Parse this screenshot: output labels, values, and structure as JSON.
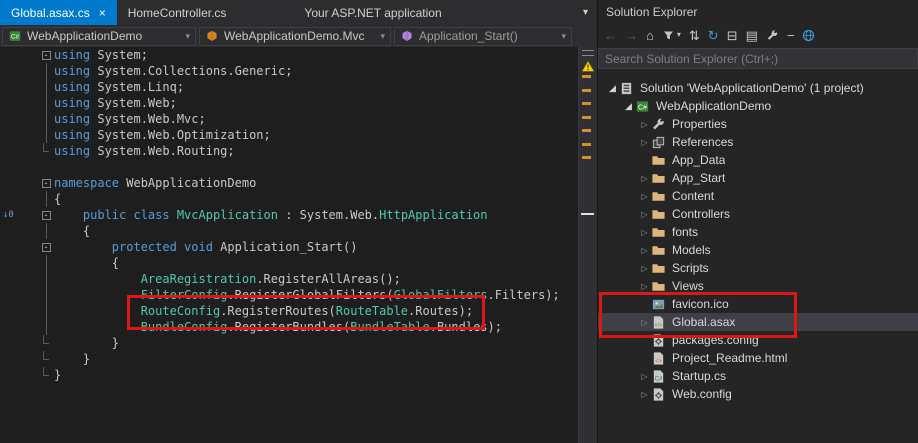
{
  "colors": {
    "accent": "#007acc",
    "annotation_red": "#dd1616",
    "keyword": "#569cd6",
    "type_name": "#4ec9b0",
    "plain_code": "#c8c8c8",
    "modified_tick": "#d18f2d",
    "warning_yellow": "#ffcc00"
  },
  "icons": {
    "close": "×",
    "chevron_down": "▾",
    "collapsed_expander": "▷",
    "expanded_expander": "◢"
  },
  "tabs": [
    {
      "label": "Global.asax.cs",
      "active": true
    },
    {
      "label": "HomeController.cs",
      "active": false
    },
    {
      "label": "Your ASP.NET application",
      "active": false,
      "gap_before": true
    }
  ],
  "navbar": {
    "project_label": "WebApplicationDemo",
    "type_label": "WebApplicationDemo.Mvc",
    "member_label": "Application_Start()"
  },
  "editor": {
    "lines": [
      {
        "fold": "start",
        "segs": [
          {
            "c": "kw",
            "t": "using"
          },
          {
            "c": "pl",
            "t": " System;"
          }
        ]
      },
      {
        "fold": "line",
        "segs": [
          {
            "c": "kw",
            "t": "using"
          },
          {
            "c": "pl",
            "t": " System.Collections.Generic;"
          }
        ]
      },
      {
        "fold": "line",
        "segs": [
          {
            "c": "kw",
            "t": "using"
          },
          {
            "c": "pl",
            "t": " System.Linq;"
          }
        ]
      },
      {
        "fold": "line",
        "segs": [
          {
            "c": "kw",
            "t": "using"
          },
          {
            "c": "pl",
            "t": " System.Web;"
          }
        ]
      },
      {
        "fold": "line",
        "segs": [
          {
            "c": "kw",
            "t": "using"
          },
          {
            "c": "pl",
            "t": " System.Web.Mvc;"
          }
        ]
      },
      {
        "fold": "line",
        "segs": [
          {
            "c": "kw",
            "t": "using"
          },
          {
            "c": "pl",
            "t": " System.Web.Optimization;"
          }
        ]
      },
      {
        "fold": "end",
        "segs": [
          {
            "c": "kw",
            "t": "using"
          },
          {
            "c": "pl",
            "t": " System.Web.Routing;"
          }
        ]
      },
      {
        "fold": "none",
        "segs": []
      },
      {
        "fold": "start",
        "segs": [
          {
            "c": "kw",
            "t": "namespace"
          },
          {
            "c": "pl",
            "t": " WebApplicationDemo"
          }
        ]
      },
      {
        "fold": "line",
        "segs": [
          {
            "c": "pl",
            "t": "{"
          }
        ]
      },
      {
        "fold": "start",
        "margin": "↓0",
        "segs": [
          {
            "c": "pl",
            "t": "    "
          },
          {
            "c": "kw",
            "t": "public class"
          },
          {
            "c": "ty",
            "t": " MvcApplication"
          },
          {
            "c": "pl",
            "t": " : System.Web."
          },
          {
            "c": "ty",
            "t": "HttpApplication"
          }
        ]
      },
      {
        "fold": "line",
        "segs": [
          {
            "c": "pl",
            "t": "    {"
          }
        ]
      },
      {
        "fold": "start",
        "segs": [
          {
            "c": "pl",
            "t": "        "
          },
          {
            "c": "kw",
            "t": "protected void"
          },
          {
            "c": "pl",
            "t": " Application_Start()"
          }
        ]
      },
      {
        "fold": "line",
        "segs": [
          {
            "c": "pl",
            "t": "        {"
          }
        ]
      },
      {
        "fold": "line",
        "segs": [
          {
            "c": "pl",
            "t": "            "
          },
          {
            "c": "ty",
            "t": "AreaRegistration"
          },
          {
            "c": "pl",
            "t": ".RegisterAllAreas();"
          }
        ]
      },
      {
        "fold": "line",
        "segs": [
          {
            "c": "pl",
            "t": "            "
          },
          {
            "c": "ty",
            "t": "FilterConfig"
          },
          {
            "c": "pl",
            "t": ".RegisterGlobalFilters("
          },
          {
            "c": "ty",
            "t": "GlobalFilters"
          },
          {
            "c": "pl",
            "t": ".Filters);"
          }
        ]
      },
      {
        "fold": "line",
        "segs": [
          {
            "c": "pl",
            "t": "            "
          },
          {
            "c": "ty",
            "t": "RouteConfig"
          },
          {
            "c": "pl",
            "t": ".RegisterRoutes("
          },
          {
            "c": "ty",
            "t": "RouteTable"
          },
          {
            "c": "pl",
            "t": ".Routes);"
          }
        ]
      },
      {
        "fold": "line",
        "segs": [
          {
            "c": "pl",
            "t": "            "
          },
          {
            "c": "ty",
            "t": "BundleConfig"
          },
          {
            "c": "pl",
            "t": ".RegisterBundles("
          },
          {
            "c": "ty",
            "t": "BundleTable"
          },
          {
            "c": "pl",
            "t": ".Bundles);"
          }
        ]
      },
      {
        "fold": "end",
        "segs": [
          {
            "c": "pl",
            "t": "        }"
          }
        ]
      },
      {
        "fold": "end",
        "segs": [
          {
            "c": "pl",
            "t": "    }"
          }
        ]
      },
      {
        "fold": "end",
        "segs": [
          {
            "c": "pl",
            "t": "}"
          }
        ]
      }
    ]
  },
  "solution_explorer": {
    "title": "Solution Explorer",
    "search_placeholder": "Search Solution Explorer (Ctrl+;)",
    "toolbar": [
      {
        "name": "back-button",
        "glyph": "←",
        "disabled": true
      },
      {
        "name": "forward-button",
        "glyph": "→",
        "disabled": true
      },
      {
        "name": "home-button",
        "glyph": "⌂"
      },
      {
        "name": "filter-button",
        "glyph": "svg:funnel",
        "caret": true
      },
      {
        "name": "sync-with-active-document-button",
        "glyph": "⇅"
      },
      {
        "name": "refresh-button",
        "glyph": "↻",
        "accent": true
      },
      {
        "name": "collapse-all-button",
        "glyph": "⊟"
      },
      {
        "name": "show-all-files-button",
        "glyph": "▤"
      },
      {
        "name": "properties-button",
        "glyph": "svg:wrench"
      },
      {
        "name": "preview-selected-items-button",
        "glyph": "−"
      },
      {
        "name": "web-button",
        "glyph": "svg:globe"
      }
    ],
    "tree": [
      {
        "label": "Solution 'WebApplicationDemo' (1 project)",
        "indent": 0,
        "icon": "solution",
        "exp": "expanded"
      },
      {
        "label": "WebApplicationDemo",
        "indent": 1,
        "icon": "project",
        "exp": "expanded"
      },
      {
        "label": "Properties",
        "indent": 2,
        "icon": "wrench",
        "exp": "collapsed"
      },
      {
        "label": "References",
        "indent": 2,
        "icon": "references",
        "exp": "collapsed"
      },
      {
        "label": "App_Data",
        "indent": 2,
        "icon": "folder",
        "exp": "none"
      },
      {
        "label": "App_Start",
        "indent": 2,
        "icon": "folder",
        "exp": "collapsed"
      },
      {
        "label": "Content",
        "indent": 2,
        "icon": "folder",
        "exp": "collapsed"
      },
      {
        "label": "Controllers",
        "indent": 2,
        "icon": "folder",
        "exp": "collapsed"
      },
      {
        "label": "fonts",
        "indent": 2,
        "icon": "folder",
        "exp": "collapsed"
      },
      {
        "label": "Models",
        "indent": 2,
        "icon": "folder",
        "exp": "collapsed"
      },
      {
        "label": "Scripts",
        "indent": 2,
        "icon": "folder",
        "exp": "collapsed"
      },
      {
        "label": "Views",
        "indent": 2,
        "icon": "folder",
        "exp": "collapsed"
      },
      {
        "label": "favicon.ico",
        "indent": 2,
        "icon": "image",
        "exp": "none"
      },
      {
        "label": "Global.asax",
        "indent": 2,
        "icon": "asax",
        "exp": "collapsed",
        "selected": true
      },
      {
        "label": "packages.config",
        "indent": 2,
        "icon": "config",
        "exp": "none"
      },
      {
        "label": "Project_Readme.html",
        "indent": 2,
        "icon": "html",
        "exp": "none"
      },
      {
        "label": "Startup.cs",
        "indent": 2,
        "icon": "cs",
        "exp": "collapsed"
      },
      {
        "label": "Web.config",
        "indent": 2,
        "icon": "config",
        "exp": "collapsed"
      }
    ]
  }
}
